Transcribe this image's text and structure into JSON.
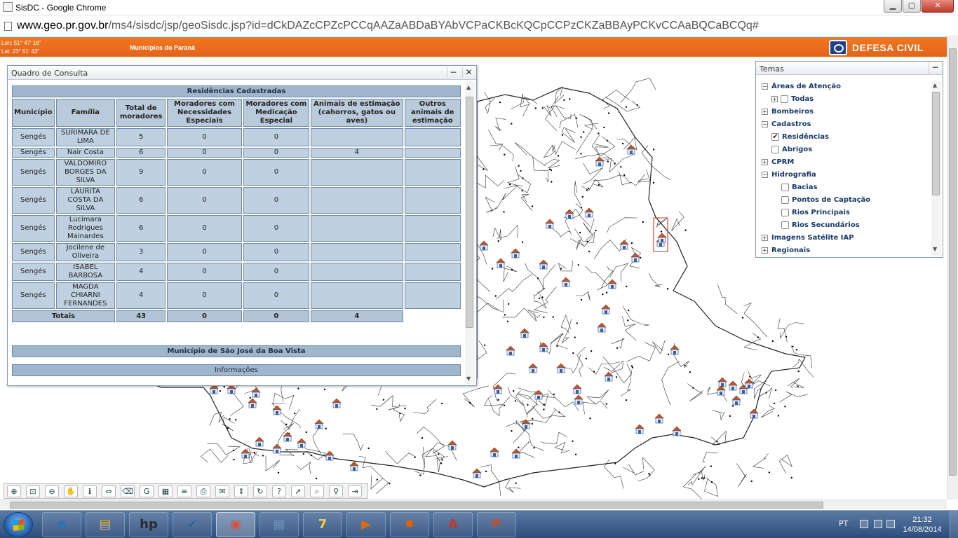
{
  "browser": {
    "window_title": "SisDC - Google Chrome",
    "url_host": "www.geo.pr.gov.br",
    "url_path": "/ms4/sisdc/jsp/geoSisdc.jsp?id=dCkDAZcCPZcPCCqAAZaABDaBYAbVCPaCKBcKQCpCCPzCKZaBBAyPCKvCCAaBQCaBCQq#"
  },
  "header": {
    "lon": "Lon: 51° 47' 16\"",
    "lat": "Lat: 23° 51' 43\"",
    "map_title": "Municípios do Paraná",
    "brand": "DEFESA CIVIL"
  },
  "dialog": {
    "title": "Quadro de Consulta",
    "section_title": "Residências Cadastradas",
    "columns": [
      "Município",
      "Família",
      "Total de moradores",
      "Moradores com Necessidades Especiais",
      "Moradores com Medicação Especial",
      "Animais de estimação (cahorros, gatos ou aves)",
      "Outros animais de estimação"
    ],
    "rows": [
      [
        "Sengés",
        "SURIMARA DE LIMA",
        "5",
        "0",
        "0",
        "",
        ""
      ],
      [
        "Sengés",
        "Nair Costa",
        "6",
        "0",
        "0",
        "4",
        ""
      ],
      [
        "Sengés",
        "VALDOMIRO BORGES DA SILVA",
        "9",
        "0",
        "0",
        "",
        ""
      ],
      [
        "Sengés",
        "LAURITA COSTA DA SILVA",
        "6",
        "0",
        "0",
        "",
        ""
      ],
      [
        "Sengés",
        "Lucimara Rodrigues Mainardes",
        "6",
        "0",
        "0",
        "",
        ""
      ],
      [
        "Sengés",
        "Jocilene de Oliveira",
        "3",
        "0",
        "0",
        "",
        ""
      ],
      [
        "Sengés",
        "ISABEL BARBOSA",
        "4",
        "0",
        "0",
        "",
        ""
      ],
      [
        "Sengés",
        "MAGDA CHIARNI FERNANDES",
        "4",
        "0",
        "0",
        "",
        ""
      ]
    ],
    "totals": {
      "label": "Totais",
      "moradores": "43",
      "necessidades": "0",
      "medicacao": "0",
      "animais": "4"
    },
    "section2_title": "Município de São José da Boa Vista",
    "section3_title": "Informações"
  },
  "temas": {
    "title": "Temas",
    "items": [
      {
        "label": "Áreas de Atenção",
        "level": 0,
        "expander": "−",
        "checkbox": null
      },
      {
        "label": "Todas",
        "level": 1,
        "expander": "+",
        "checkbox": ""
      },
      {
        "label": "Bombeiros",
        "level": 0,
        "expander": "+",
        "checkbox": null
      },
      {
        "label": "Cadastros",
        "level": 0,
        "expander": "−",
        "checkbox": null
      },
      {
        "label": "Residências",
        "level": 1,
        "expander": null,
        "checkbox": "✔"
      },
      {
        "label": "Abrigos",
        "level": 1,
        "expander": null,
        "checkbox": ""
      },
      {
        "label": "CPRM",
        "level": 0,
        "expander": "+",
        "checkbox": null
      },
      {
        "label": "Hidrografia",
        "level": 0,
        "expander": "−",
        "checkbox": null
      },
      {
        "label": "Bacias",
        "level": 2,
        "expander": null,
        "checkbox": ""
      },
      {
        "label": "Pontos de Captação",
        "level": 2,
        "expander": null,
        "checkbox": ""
      },
      {
        "label": "Rios Principais",
        "level": 2,
        "expander": null,
        "checkbox": ""
      },
      {
        "label": "Rios Secundários",
        "level": 2,
        "expander": null,
        "checkbox": ""
      },
      {
        "label": "Imagens Satélite IAP",
        "level": 0,
        "expander": "+",
        "checkbox": null
      },
      {
        "label": "Regionais",
        "level": 0,
        "expander": "+",
        "checkbox": null
      }
    ]
  },
  "toolbar": {
    "tools": [
      "zoom-in-icon",
      "zoom-extent-icon",
      "zoom-out-icon",
      "pan-hand-icon",
      "info-icon",
      "measure-icon",
      "eraser-icon",
      "google-icon",
      "table-icon",
      "legend-icon",
      "print-icon",
      "email-icon",
      "scale-icon",
      "refresh-icon",
      "help-icon",
      "pointer-icon",
      "search-icon",
      "binoculars-icon",
      "exit-icon"
    ],
    "glyphs": [
      "⊕",
      "⊡",
      "⊖",
      "✋",
      "ℹ",
      "⇔",
      "⌫",
      "G",
      "▦",
      "≡",
      "⎙",
      "✉",
      "⇕",
      "↻",
      "?",
      "➚",
      "⌕",
      "⚲",
      "⇥"
    ]
  },
  "taskbar": {
    "apps": [
      "Internet Explorer",
      "Windows Explorer",
      "HP",
      "Task",
      "Google Chrome",
      "Calculator",
      "Sticky",
      "Media",
      "Firefox",
      "PDF",
      "PowerPoint"
    ],
    "glyphs": [
      "e",
      "▤",
      "hp",
      "✓",
      "◉",
      "▦",
      "7",
      "▶",
      "✹",
      "A",
      "P"
    ],
    "language": "PT",
    "time": "21:32",
    "date": "14/08/2014"
  },
  "colors": {
    "header_orange": "#e96c1c",
    "table_header": "#9fb6cc",
    "taskbar": "#2d4e7a"
  }
}
